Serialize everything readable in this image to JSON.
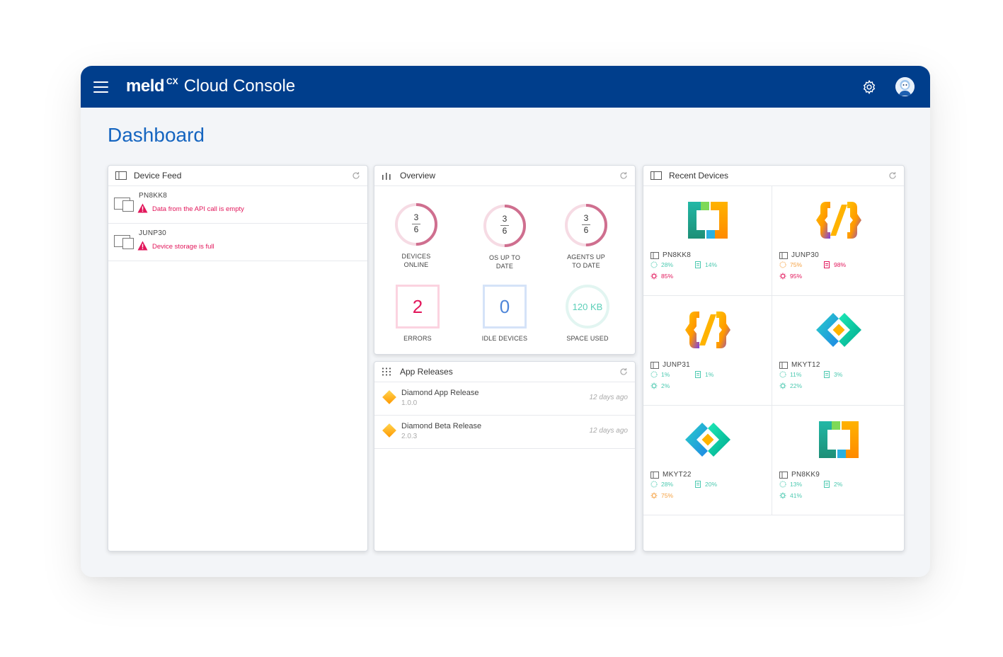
{
  "header": {
    "brand_meld": "meld",
    "brand_cx": "CX",
    "brand_title": "Cloud Console"
  },
  "page_title": "Dashboard",
  "device_feed": {
    "title": "Device Feed",
    "items": [
      {
        "name": "PN8KK8",
        "message": "Data from the API call is empty"
      },
      {
        "name": "JUNP30",
        "message": "Device storage is full"
      }
    ]
  },
  "overview": {
    "title": "Overview",
    "stats": [
      {
        "num": "3",
        "den": "6",
        "label1": "DEVICES",
        "label2": "ONLINE",
        "fraction": 0.5
      },
      {
        "num": "3",
        "den": "6",
        "label1": "OS UP TO",
        "label2": "DATE",
        "fraction": 0.5
      },
      {
        "num": "3",
        "den": "6",
        "label1": "AGENTS UP",
        "label2": "TO DATE",
        "fraction": 0.5
      }
    ],
    "errors": {
      "value": "2",
      "label": "ERRORS"
    },
    "idle": {
      "value": "0",
      "label": "IDLE DEVICES"
    },
    "space": {
      "value": "120 KB",
      "label": "SPACE USED"
    }
  },
  "app_releases": {
    "title": "App Releases",
    "items": [
      {
        "name": "Diamond App Release",
        "version": "1.0.0",
        "time": "12 days ago"
      },
      {
        "name": "Diamond Beta Release",
        "version": "2.0.3",
        "time": "12 days ago"
      }
    ]
  },
  "recent_devices": {
    "title": "Recent Devices",
    "devices": [
      {
        "name": "PN8KK8",
        "logo": "brackets-logo",
        "m1": "28%",
        "m2": "14%",
        "m3": "85%",
        "c1": "#4cc9b0",
        "c2": "#4cc9b0",
        "c3": "#e2175b"
      },
      {
        "name": "JUNP30",
        "logo": "braces-logo",
        "m1": "75%",
        "m2": "98%",
        "m3": "95%",
        "c1": "#f5a142",
        "c2": "#e2175b",
        "c3": "#e2175b"
      },
      {
        "name": "JUNP31",
        "logo": "braces-logo",
        "m1": "1%",
        "m2": "1%",
        "m3": "2%",
        "c1": "#4cc9b0",
        "c2": "#4cc9b0",
        "c3": "#4cc9b0"
      },
      {
        "name": "MKYT12",
        "logo": "chevrons-logo",
        "m1": "11%",
        "m2": "3%",
        "m3": "22%",
        "c1": "#4cc9b0",
        "c2": "#4cc9b0",
        "c3": "#4cc9b0"
      },
      {
        "name": "MKYT22",
        "logo": "chevrons-logo",
        "m1": "28%",
        "m2": "20%",
        "m3": "75%",
        "c1": "#4cc9b0",
        "c2": "#4cc9b0",
        "c3": "#f5a142"
      },
      {
        "name": "PN8KK9",
        "logo": "brackets-logo",
        "m1": "13%",
        "m2": "2%",
        "m3": "41%",
        "c1": "#4cc9b0",
        "c2": "#4cc9b0",
        "c3": "#4cc9b0"
      }
    ]
  },
  "colors": {
    "header": "#003e8c",
    "title": "#1565c0",
    "error": "#e2175b",
    "idle": "#4f86d9",
    "space": "#5ccfb8",
    "ring": "#cf6f8f"
  }
}
